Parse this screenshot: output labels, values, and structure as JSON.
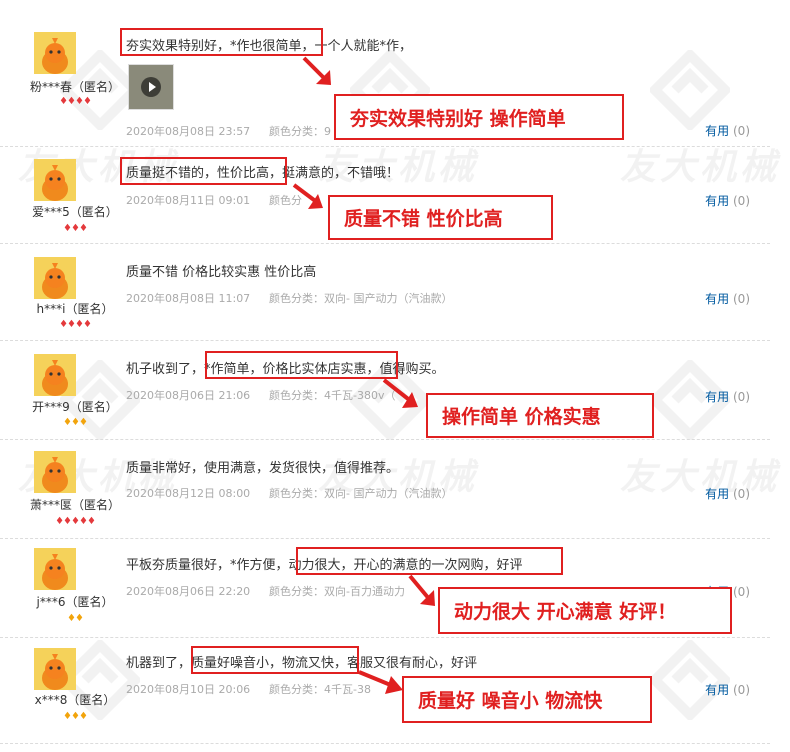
{
  "watermark": {
    "text": "友大机械"
  },
  "reviews": [
    {
      "username": "粉***春（匿名）",
      "level": "red",
      "level_icons": "♦♦♦♦",
      "content": "夯实效果特别好，*作也很简单，一个人就能*作，",
      "date": "2020年08月08日 23:57",
      "variant": "颜色分类：9",
      "useful_label": "有用",
      "useful_count": "(0)",
      "has_video": true,
      "callout": "夯实效果特别好  操作简单"
    },
    {
      "username": "爱***5（匿名）",
      "level": "red",
      "level_icons": "♦♦♦",
      "content": "质量挺不错的，性价比高，挺满意的，不错哦！",
      "date": "2020年08月11日 09:01",
      "variant": "颜色分",
      "useful_label": "有用",
      "useful_count": "(0)",
      "callout": "质量不错  性价比高"
    },
    {
      "username": "h***i（匿名）",
      "level": "red",
      "level_icons": "♦♦♦♦",
      "content": "质量不错 价格比较实惠 性价比高",
      "date": "2020年08月08日 11:07",
      "variant": "颜色分类：双向- 国产动力（汽油款）",
      "useful_label": "有用",
      "useful_count": "(0)"
    },
    {
      "username": "开***9（匿名）",
      "level": "gold",
      "level_icons": "♦♦♦",
      "content": "机子收到了，*作简单，价格比实体店实惠，值得购买。",
      "date": "2020年08月06日 21:06",
      "variant": "颜色分类：4千瓦-380v（",
      "useful_label": "有用",
      "useful_count": "(0)",
      "callout": "操作简单  价格实惠"
    },
    {
      "username": "萧***匽（匿名）",
      "level": "red",
      "level_icons": "♦♦♦♦♦",
      "content": "质量非常好，使用满意，发货很快，值得推荐。",
      "date": "2020年08月12日 08:00",
      "variant": "颜色分类：双向- 国产动力（汽油款）",
      "useful_label": "有用",
      "useful_count": "(0)"
    },
    {
      "username": "j***6（匿名）",
      "level": "gold",
      "level_icons": "♦♦",
      "content": "平板夯质量很好，*作方便，动力很大，开心的满意的一次网购，好评",
      "date": "2020年08月06日 22:20",
      "variant": "颜色分类：双向-百力通动力",
      "useful_label": "有用",
      "useful_count": "(0)",
      "callout": "动力很大  开心满意  好评！"
    },
    {
      "username": "x***8（匿名）",
      "level": "gold",
      "level_icons": "♦♦♦",
      "content": "机器到了，质量好噪音小，物流又快，客服又很有耐心，好评",
      "date": "2020年08月10日 20:06",
      "variant": "颜色分类：4千瓦-38",
      "useful_label": "有用",
      "useful_count": "(0)",
      "callout": "质量好  噪音小  物流快"
    }
  ],
  "colors": {
    "accent_red": "#e02020",
    "link_blue": "#005aa0",
    "level_red": "#e4393c",
    "level_gold": "#f2a40c"
  }
}
